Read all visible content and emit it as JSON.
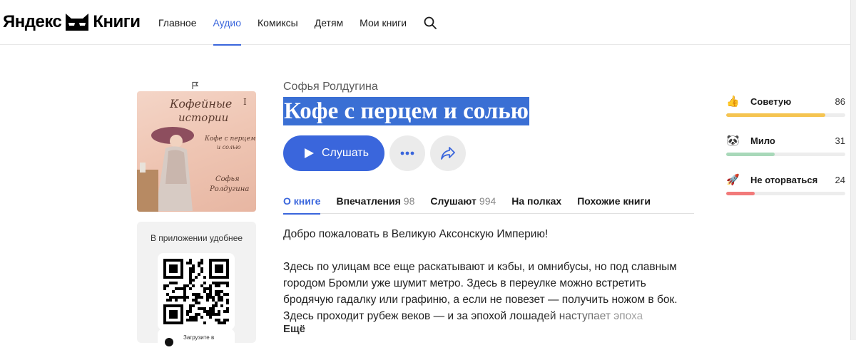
{
  "header": {
    "logo_word1": "Яндекс",
    "logo_word2": "Книги",
    "nav": [
      {
        "label": "Главное"
      },
      {
        "label": "Аудио",
        "active": true
      },
      {
        "label": "Комиксы"
      },
      {
        "label": "Детям"
      },
      {
        "label": "Мои книги"
      }
    ],
    "search_icon": "search-icon",
    "accent_color": "#3a66dc"
  },
  "book": {
    "author": "Софья Ролдугина",
    "title": "Кофе с перцем и солью",
    "cover": {
      "series_line1": "Кофейные",
      "series_line2": "истории",
      "volume": "I",
      "title_line1": "Кофе с перцем",
      "title_line2": "и солью",
      "author_line1": "Софья",
      "author_line2": "Ролдугина"
    },
    "listen_label": "Слушать",
    "more_icon": "more-icon",
    "share_icon": "share-icon"
  },
  "app_promo": {
    "caption": "В приложении удобнее",
    "store_text": "Загрузите в"
  },
  "tabs": [
    {
      "label": "О книге",
      "count": "",
      "active": true
    },
    {
      "label": "Впечатления",
      "count": "98"
    },
    {
      "label": "Слушают",
      "count": "994"
    },
    {
      "label": "На полках",
      "count": ""
    },
    {
      "label": "Похожие книги",
      "count": ""
    }
  ],
  "description": {
    "p1": "Добро пожаловать в Великую Аксонскую Империю!",
    "p2": "Здесь по улицам все еще раскатывают и кэбы, и омнибусы, но под славным городом Бромли уже шумит метро. Здесь в переулке можно встретить бродячую гадалку или графиню, а если не повезет — получить ножом в бок. Здесь проходит рубеж веков — и за эпохой лошадей наступает эпоха",
    "more_label": "Ещё"
  },
  "ratings": [
    {
      "icon": "thumbs-up-icon",
      "glyph": "👍",
      "label": "Советую",
      "count": "86",
      "fraction": 0.83,
      "color": "#f5c451"
    },
    {
      "icon": "panda-icon",
      "glyph": "🐼",
      "label": "Мило",
      "count": "31",
      "fraction": 0.41,
      "color": "#a8d8b9"
    },
    {
      "icon": "rocket-icon",
      "glyph": "🚀",
      "label": "Не оторваться",
      "count": "24",
      "fraction": 0.24,
      "color": "#f27a7a"
    }
  ]
}
